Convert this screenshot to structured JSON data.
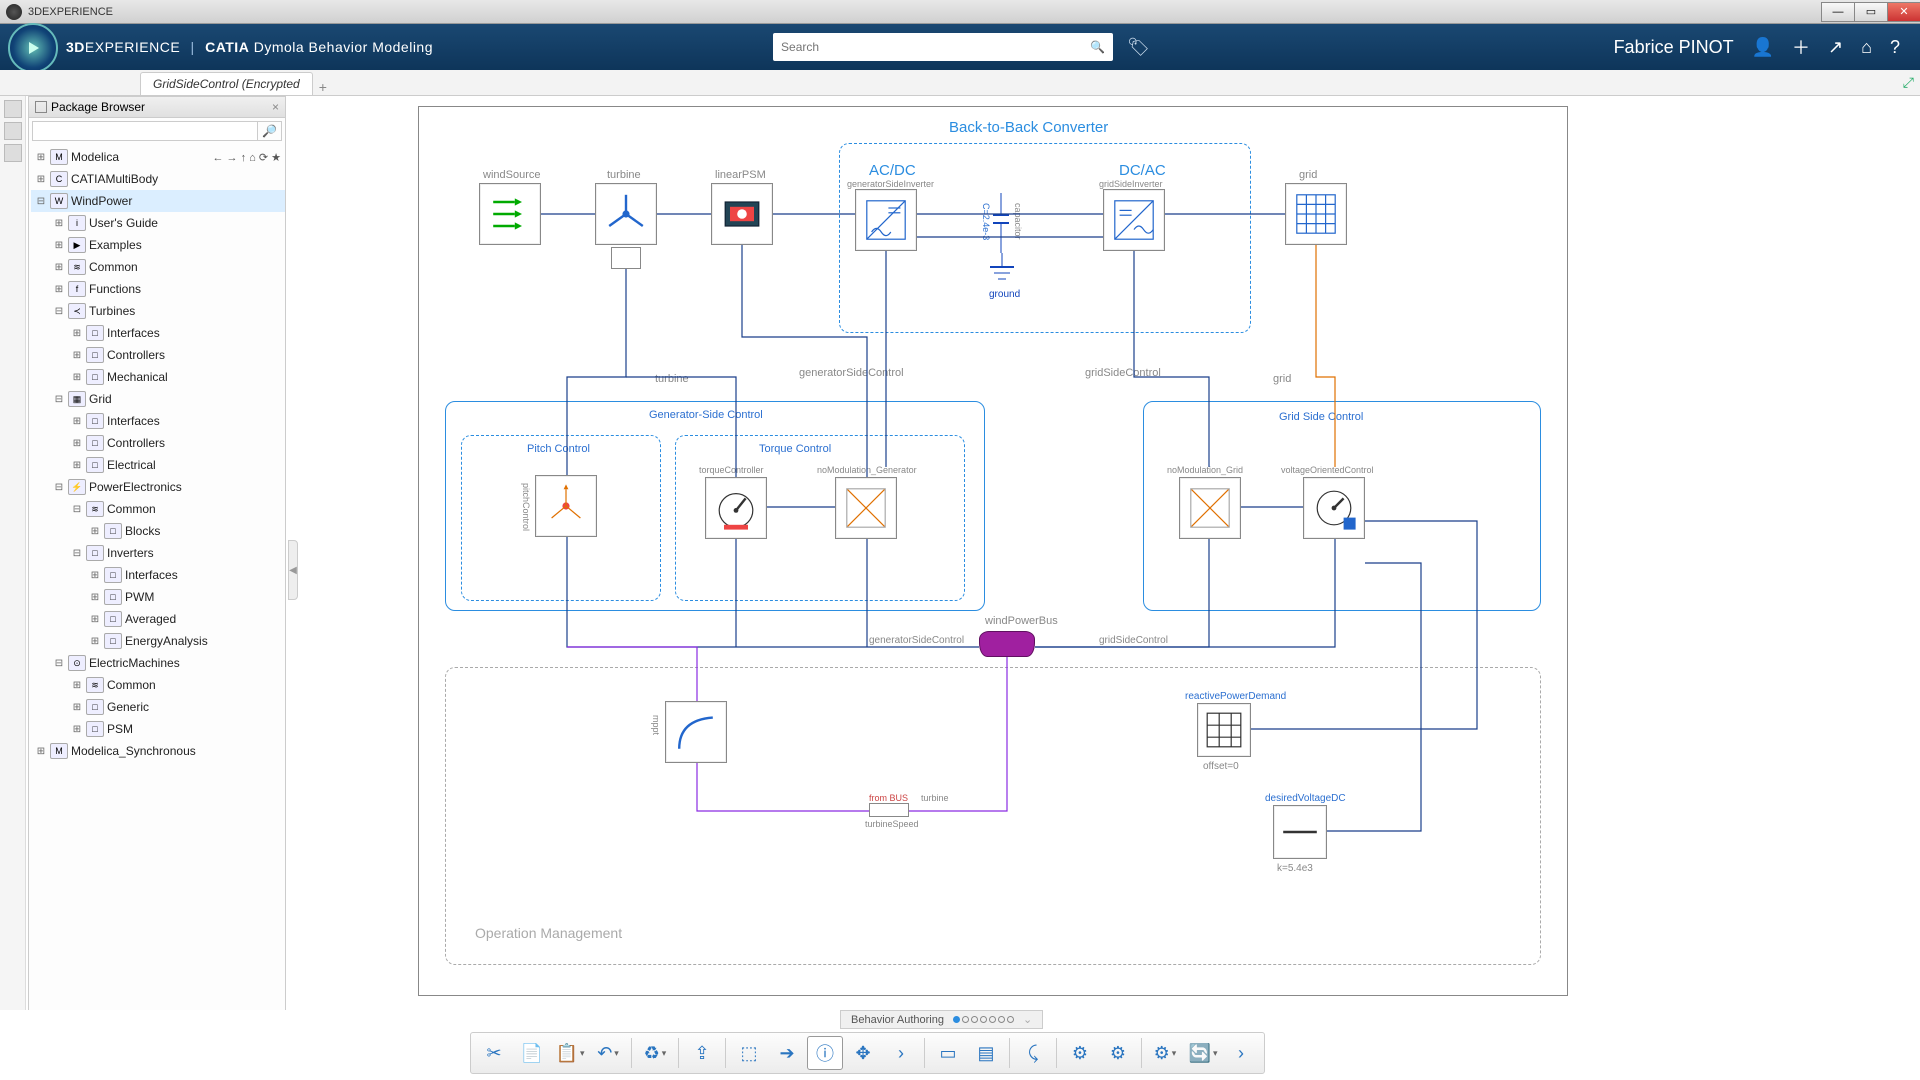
{
  "window": {
    "title": "3DEXPERIENCE"
  },
  "topbar": {
    "brand_pre": "3D",
    "brand_exp": "EXPERIENCE",
    "brand_catia": "CATIA",
    "brand_rest": "Dymola Behavior Modeling",
    "search_placeholder": "Search",
    "user": "Fabrice PINOT"
  },
  "tab": {
    "name": "GridSideControl (Encrypted"
  },
  "browser": {
    "title": "Package Browser",
    "tree": [
      {
        "d": 0,
        "tw": "+",
        "icn": "M",
        "lbl": "Modelica",
        "nav": true
      },
      {
        "d": 0,
        "tw": "+",
        "icn": "C",
        "lbl": "CATIAMultiBody"
      },
      {
        "d": 0,
        "tw": "-",
        "icn": "W",
        "lbl": "WindPower",
        "sel": true
      },
      {
        "d": 1,
        "tw": "+",
        "icn": "i",
        "lbl": "User's Guide"
      },
      {
        "d": 1,
        "tw": "+",
        "icn": "▶",
        "lbl": "Examples"
      },
      {
        "d": 1,
        "tw": "+",
        "icn": "≋",
        "lbl": "Common"
      },
      {
        "d": 1,
        "tw": "+",
        "icn": "f",
        "lbl": "Functions"
      },
      {
        "d": 1,
        "tw": "-",
        "icn": "≺",
        "lbl": "Turbines"
      },
      {
        "d": 2,
        "tw": "+",
        "icn": "□",
        "lbl": "Interfaces"
      },
      {
        "d": 2,
        "tw": "+",
        "icn": "□",
        "lbl": "Controllers"
      },
      {
        "d": 2,
        "tw": "+",
        "icn": "□",
        "lbl": "Mechanical"
      },
      {
        "d": 1,
        "tw": "-",
        "icn": "▦",
        "lbl": "Grid"
      },
      {
        "d": 2,
        "tw": "+",
        "icn": "□",
        "lbl": "Interfaces"
      },
      {
        "d": 2,
        "tw": "+",
        "icn": "□",
        "lbl": "Controllers"
      },
      {
        "d": 2,
        "tw": "+",
        "icn": "□",
        "lbl": "Electrical"
      },
      {
        "d": 1,
        "tw": "-",
        "icn": "⚡",
        "lbl": "PowerElectronics"
      },
      {
        "d": 2,
        "tw": "-",
        "icn": "≋",
        "lbl": "Common"
      },
      {
        "d": 3,
        "tw": "+",
        "icn": "□",
        "lbl": "Blocks"
      },
      {
        "d": 2,
        "tw": "-",
        "icn": "□",
        "lbl": "Inverters"
      },
      {
        "d": 3,
        "tw": "+",
        "icn": "□",
        "lbl": "Interfaces"
      },
      {
        "d": 3,
        "tw": "+",
        "icn": "□",
        "lbl": "PWM"
      },
      {
        "d": 3,
        "tw": "+",
        "icn": "□",
        "lbl": "Averaged"
      },
      {
        "d": 3,
        "tw": "+",
        "icn": "□",
        "lbl": "EnergyAnalysis"
      },
      {
        "d": 1,
        "tw": "-",
        "icn": "⊙",
        "lbl": "ElectricMachines"
      },
      {
        "d": 2,
        "tw": "+",
        "icn": "≋",
        "lbl": "Common"
      },
      {
        "d": 2,
        "tw": "+",
        "icn": "□",
        "lbl": "Generic"
      },
      {
        "d": 2,
        "tw": "+",
        "icn": "□",
        "lbl": "PSM"
      },
      {
        "d": 0,
        "tw": "+",
        "icn": "M",
        "lbl": "Modelica_Synchronous"
      }
    ]
  },
  "diagram": {
    "groups": {
      "b2b": "Back-to-Back Converter",
      "acdc": "AC/DC",
      "dcac": "DC/AC",
      "gensctrl": "Generator-Side Control",
      "pitch": "Pitch Control",
      "torque": "Torque Control",
      "gridctrl": "Grid Side Control",
      "opman": "Operation Management"
    },
    "blocks": {
      "windSource": "windSource",
      "turbine": "turbine",
      "linearPSM": "linearPSM",
      "genInv": "generatorSideInverter",
      "gridInv": "gridSideInverter",
      "grid": "grid",
      "capacitor": "capacitor",
      "capval": "C=2.4e-3",
      "ground": "ground",
      "pitchControl": "pitchControl",
      "torqueController": "torqueController",
      "noModGen": "noModulation_Generator",
      "noModGrid": "noModulation_Grid",
      "voc": "voltageOrientedControl",
      "genSideCtrl": "generatorSideControl",
      "gridSideCtrl": "gridSideControl",
      "turbineLbl": "turbine",
      "gridLbl": "grid",
      "windPowerBus": "windPowerBus",
      "reactivePower": "reactivePowerDemand",
      "offset": "offset=0",
      "desiredVdc": "desiredVoltageDC",
      "kval": "k=5.4e3",
      "mppt": "mppt",
      "fromBus": "from BUS",
      "turbineSpeed": "turbineSpeed"
    }
  },
  "bottom": {
    "behavior": "Behavior Authoring"
  }
}
